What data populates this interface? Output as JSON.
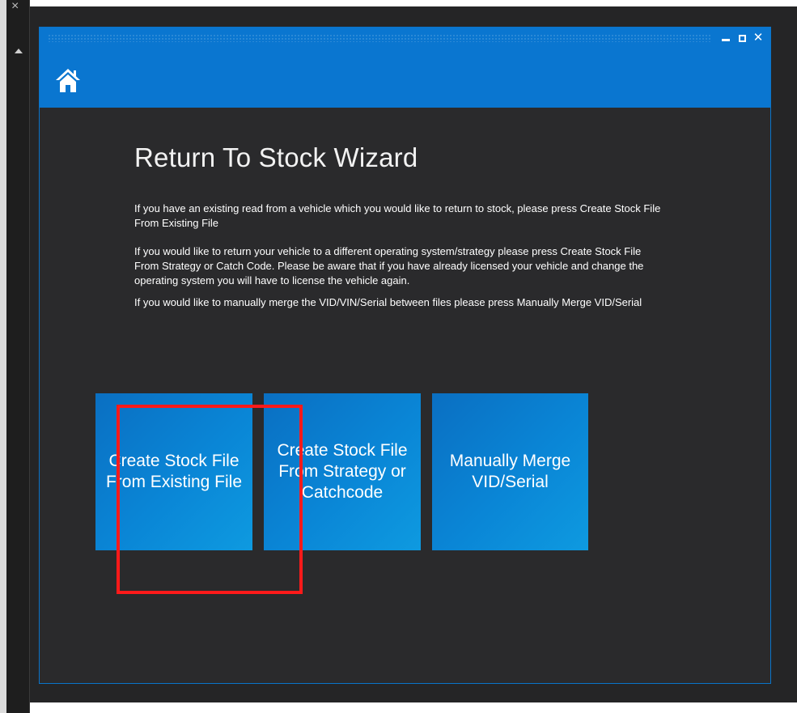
{
  "window": {
    "title": "",
    "controls": {
      "minimize": "minimize",
      "maximize": "maximize",
      "close": "✕"
    }
  },
  "wizard": {
    "title": "Return To Stock Wizard",
    "paragraphs": [
      "If you have an existing read from a vehicle which you would like to return to stock, please press Create Stock File From Existing File",
      "If you would like to return your vehicle to a different operating system/strategy please press Create Stock File From Strategy or Catch Code. Please be aware that if you have already licensed your vehicle and change the operating system you will have to license the vehicle again.",
      "If you would like to manually merge the VID/VIN/Serial between files please press Manually Merge VID/Serial"
    ],
    "tiles": [
      {
        "label": "Create Stock File From Existing File"
      },
      {
        "label": "Create Stock File From Strategy or Catchcode"
      },
      {
        "label": "Manually Merge VID/Serial"
      }
    ]
  },
  "background": {
    "scroll_close": "×"
  },
  "colors": {
    "titlebar": "#0a76d0",
    "tile": "#0a86d6",
    "highlight": "#ff1a1a",
    "window_bg": "#2a2a2c"
  },
  "icons": {
    "home": "home-icon"
  }
}
